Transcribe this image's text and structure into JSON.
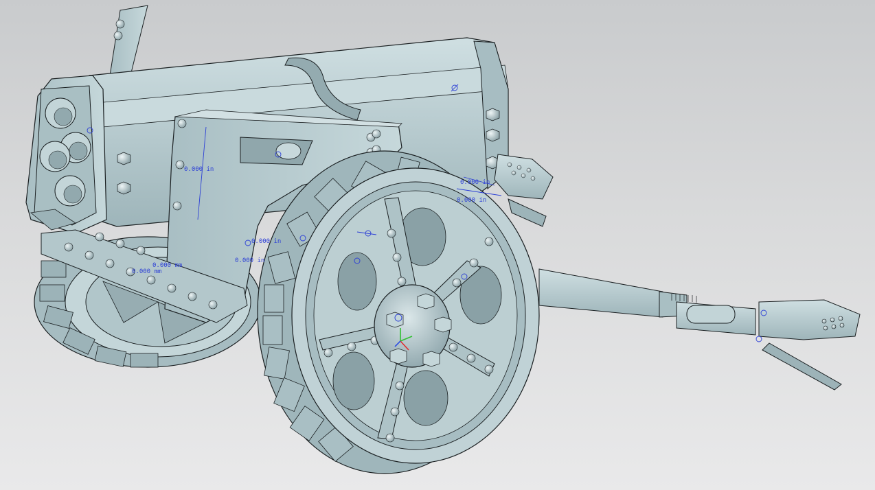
{
  "viewport": {
    "background_top": "#c9cbcd",
    "background_bottom": "#e9e9ea"
  },
  "model": {
    "body_color": "#b4c8cc",
    "body_dark": "#8fa6ab",
    "body_light": "#d5e3e6",
    "edge_color": "#1a1f21"
  },
  "annotations": {
    "color": "#2c3fd6",
    "labels": [
      "0.000 in",
      "0.000 in",
      "0.000 in",
      "0.000 in",
      "0.000 in",
      "0.000 mm",
      "0.000 mm"
    ]
  },
  "triad": {
    "x_color": "#e03030",
    "y_color": "#30c030",
    "z_color": "#3050e0"
  }
}
